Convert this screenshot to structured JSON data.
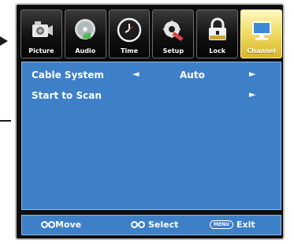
{
  "tabs": [
    {
      "label": "Picture",
      "icon": "camera-icon"
    },
    {
      "label": "Audio",
      "icon": "audio-disc-icon"
    },
    {
      "label": "Time",
      "icon": "clock-icon"
    },
    {
      "label": "Setup",
      "icon": "setup-gear-icon"
    },
    {
      "label": "Lock",
      "icon": "lock-icon"
    },
    {
      "label": "Channel",
      "icon": "channel-monitor-icon"
    }
  ],
  "active_tab": "Channel",
  "menu_items": [
    {
      "label": "Cable System",
      "value": "Auto",
      "left_arrow": "◄",
      "right_arrow": "►"
    },
    {
      "label": "Start to Scan",
      "right_arrow": "►"
    }
  ],
  "help": {
    "move": "Move",
    "select": "Select",
    "menu_key": "MENU",
    "exit": "Exit"
  },
  "colors": {
    "panel_blue": "#3d80c8",
    "active_tab_gold": "#f1de69",
    "bezel": "#0d0d0d"
  }
}
